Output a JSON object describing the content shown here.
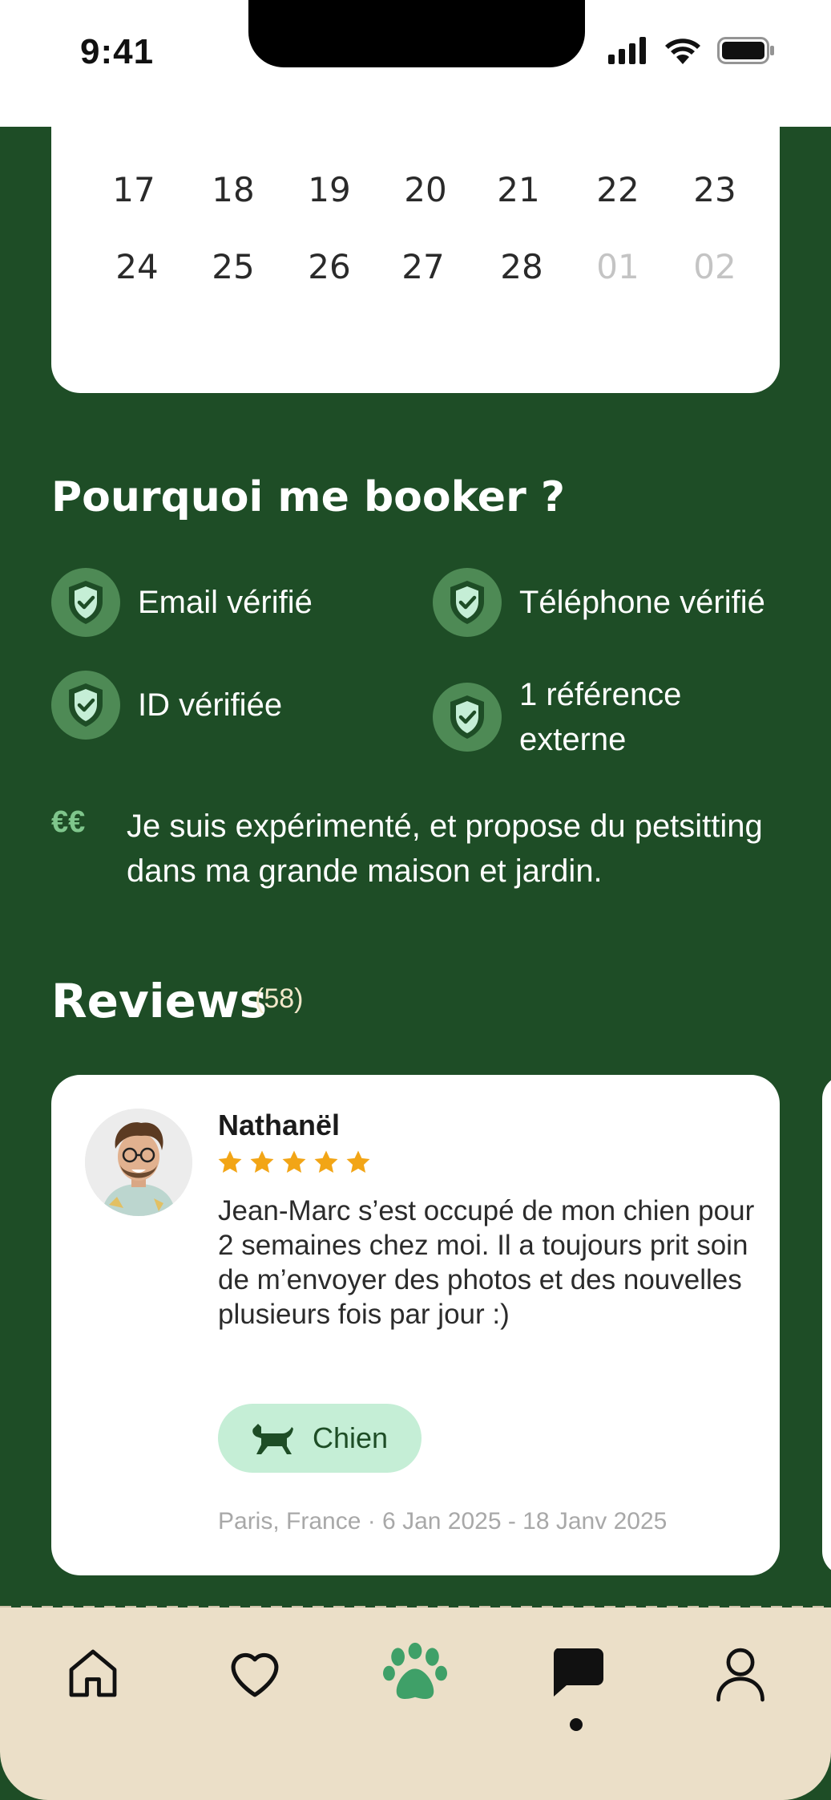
{
  "status_bar": {
    "time": "9:41"
  },
  "calendar": {
    "rows": [
      {
        "days": [
          {
            "d": "17",
            "muted": false
          },
          {
            "d": "18",
            "muted": false
          },
          {
            "d": "19",
            "muted": false
          },
          {
            "d": "20",
            "muted": false
          },
          {
            "d": "21",
            "muted": false
          },
          {
            "d": "22",
            "muted": false
          },
          {
            "d": "23",
            "muted": false
          }
        ]
      },
      {
        "days": [
          {
            "d": "24",
            "muted": false
          },
          {
            "d": "25",
            "muted": false
          },
          {
            "d": "26",
            "muted": false
          },
          {
            "d": "27",
            "muted": false
          },
          {
            "d": "28",
            "muted": false
          },
          {
            "d": "01",
            "muted": true
          },
          {
            "d": "02",
            "muted": true
          }
        ]
      }
    ]
  },
  "why_book": {
    "title": "Pourquoi me booker ?",
    "badges": [
      {
        "label": "Email vérifié"
      },
      {
        "label": "Téléphone vérifié"
      },
      {
        "label": "ID vérifiée"
      },
      {
        "label": "1 référence externe"
      }
    ],
    "price_symbol": "€€",
    "bio": "Je suis expérimenté, et propose du petsitting dans ma grande maison et jardin."
  },
  "reviews": {
    "title": "Reviews",
    "count": "(58)",
    "items": [
      {
        "name": "Nathanël",
        "rating": 5,
        "text": "Jean-Marc s’est occupé de mon chien pour 2 semaines chez moi. Il a toujours prit soin de m’envoyer des photos et des nouvelles plusieurs fois par jour :)",
        "pet": "Chien",
        "meta": "Paris, France · 6 Jan 2025 - 18 Janv 2025"
      }
    ]
  },
  "colors": {
    "background": "#1e4d26",
    "accent": "#3fa068",
    "star": "#f2a516",
    "chip": "#c5eed6",
    "nav_bg": "#ebdfc8"
  },
  "nav": {
    "items": [
      {
        "icon": "home-icon"
      },
      {
        "icon": "heart-icon"
      },
      {
        "icon": "paw-icon",
        "active": true
      },
      {
        "icon": "chat-icon",
        "has_notification": true
      },
      {
        "icon": "profile-icon"
      }
    ]
  }
}
